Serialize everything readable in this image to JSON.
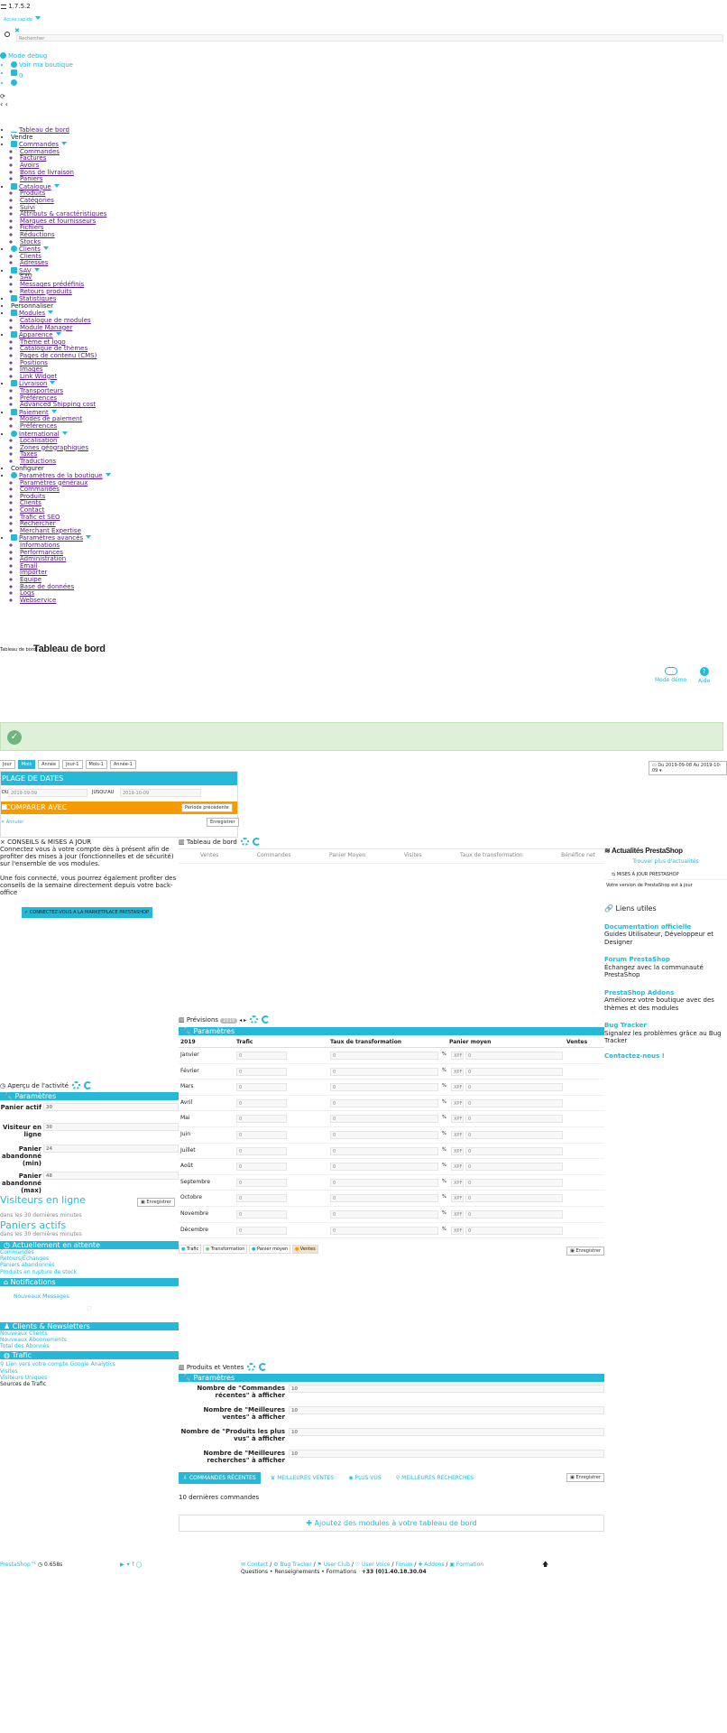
{
  "header": {
    "version": "1.7.5.2",
    "quick_access": "Accès rapide",
    "search_placeholder": "Rechercher",
    "debug_mode": "Mode debug",
    "view_shop": "Voir ma boutique",
    "notif_count": "0"
  },
  "nav": {
    "dashboard": "Tableau de bord",
    "section_sell": "Vendre",
    "orders": {
      "label": "Commandes",
      "items": [
        "Commandes",
        "Factures",
        "Avoirs",
        "Bons de livraison",
        "Paniers"
      ]
    },
    "catalog": {
      "label": "Catalogue",
      "items": [
        "Produits",
        "Catégories",
        "Suivi",
        "Attributs & caractéristiques",
        "Marques et fournisseurs",
        "Fichiers",
        "Réductions",
        "Stocks"
      ]
    },
    "customers": {
      "label": "Clients",
      "items": [
        "Clients",
        "Adresses"
      ]
    },
    "sav": {
      "label": "SAV",
      "items": [
        "SAV",
        "Messages prédéfinis",
        "Retours produits"
      ]
    },
    "stats": "Statistiques",
    "section_customize": "Personnaliser",
    "modules": {
      "label": "Modules",
      "items": [
        "Catalogue de modules",
        "Module Manager"
      ]
    },
    "appearance": {
      "label": "Apparence",
      "items": [
        "Thème et logo",
        "Catalogue de thèmes",
        "Pages de contenu (CMS)",
        "Positions",
        "Images",
        "Link Widget"
      ]
    },
    "shipping": {
      "label": "Livraison",
      "items": [
        "Transporteurs",
        "Préférences",
        "Advanced Shipping cost"
      ]
    },
    "payment": {
      "label": "Paiement",
      "items": [
        "Modes de paiement",
        "Préférences"
      ]
    },
    "international": {
      "label": "International",
      "items": [
        "Localisation",
        "Zones géographiques",
        "Taxes",
        "Traductions"
      ]
    },
    "section_configure": "Configurer",
    "shop_params": {
      "label": "Paramètres de la boutique",
      "items": [
        "Paramètres généraux",
        "Commandes",
        "Produits",
        "Clients",
        "Contact",
        "Trafic et SEO",
        "Rechercher",
        "Merchant Expertise"
      ]
    },
    "adv_params": {
      "label": "Paramètres avancés",
      "items": [
        "Informations",
        "Performances",
        "Administration",
        "Email",
        "Importer",
        "Equipe",
        "Base de données",
        "Logs",
        "Webservice"
      ]
    }
  },
  "page": {
    "breadcrumb": "Tableau de bord",
    "title": "Tableau de bord",
    "demo_mode": "Mode démo",
    "help": "Aide"
  },
  "date_bar": {
    "tabs": [
      "Jour",
      "Mois",
      "Année",
      "Jour-1",
      "Mois-1",
      "Année-1"
    ],
    "range": "Du 2019-09-08 Au 2019-10-09"
  },
  "date_panel": {
    "title": "PLAGE DE DATES",
    "from_label": "DU",
    "from_value": "2019-09-09",
    "to_label": "JUSQU'AU",
    "to_value": "2019-10-09",
    "compare_title": "COMPARER AVEC",
    "compare_select": "Période précédente",
    "cancel": "Annuler",
    "save": "Enregistrer"
  },
  "conseils": {
    "title": "CONSEILS & MISES A JOUR",
    "p1": "Connectez vous à votre compte dès à présent afin de profiter des mises à jour (fonctionnelles et de sécurité) sur l'ensemble de vos modules.",
    "p2": "Une fois connecté, vous pourrez également profiter des conseils de la semaine directement depuis votre back-office",
    "button": "CONNECTEZ-VOUS A LA MARKETPLACE PRESTASHOP"
  },
  "dashboard_kpis": {
    "title": "Tableau de bord",
    "cols": [
      "Ventes",
      "Commandes",
      "Panier Moyen",
      "Visites",
      "Taux de transformation",
      "Bénéfice net"
    ]
  },
  "news": {
    "title": "Actualités PrestaShop",
    "more": "Trouver plus d'actualités",
    "updates_title": "MISES À JOUR PRESTASHOP",
    "updates_text": "Votre version de PrestaShop est à jour"
  },
  "useful_links": {
    "title": "Liens utiles",
    "items": [
      {
        "title": "Documentation officielle",
        "desc": "Guides Utilisateur, Développeur et Designer"
      },
      {
        "title": "Forum PrestaShop",
        "desc": "Échangez avec la communauté PrestaShop"
      },
      {
        "title": "PrestaShop Addons",
        "desc": "Améliorez votre boutique avec des thèmes et des modules"
      },
      {
        "title": "Bug Tracker",
        "desc": "Signalez les problèmes grâce au Bug Tracker"
      }
    ],
    "contact": "Contactez-nous !"
  },
  "forecast": {
    "title": "Prévisions",
    "year_badge": "2019",
    "params": "Paramètres",
    "year": "2019",
    "cols": [
      "Trafic",
      "Taux de transformation",
      "Panier moyen",
      "Ventes"
    ],
    "months": [
      "Janvier",
      "Février",
      "Mars",
      "Avril",
      "Mai",
      "Juin",
      "Juillet",
      "Août",
      "Septembre",
      "Octobre",
      "Novembre",
      "Décembre"
    ],
    "default_value": "0",
    "percent": "%",
    "currency": "XPF",
    "legend": [
      "Trafic",
      "Transformation",
      "Panier moyen",
      "Ventes"
    ],
    "save": "Enregistrer"
  },
  "activity": {
    "title": "Aperçu de l'activité",
    "params": "Paramètres",
    "fields": [
      {
        "label": "Panier actif",
        "value": "30"
      },
      {
        "label": "Visiteur en ligne",
        "value": "30"
      },
      {
        "label": "Panier abandonné (min)",
        "value": "24"
      },
      {
        "label": "Panier abandonné (max)",
        "value": "48"
      }
    ],
    "save": "Enregistrer",
    "visitors_title": "Visiteurs en ligne",
    "visitors_sub": "dans les 30 dernières minutes",
    "carts_title": "Paniers actifs",
    "carts_sub": "dans les 30 dernières minutes",
    "pending_title": "Actuellement en attente",
    "pending_items": [
      "Commandes",
      "Retours/Échanges",
      "Paniers abandonnés",
      "Produits en rupture de stock"
    ],
    "notif_title": "Notifications",
    "notif_link": "Nouveaux Messages",
    "clients_title": "Clients & Newsletters",
    "clients_items": [
      "Nouveaux Clients",
      "Nouveaux Abonnements",
      "Total des Abonnés"
    ],
    "traffic_title": "Trafic",
    "traffic_items": [
      "Lien vers votre compte Google Analytics",
      "Visites",
      "Visiteurs Uniques",
      "Sources de Trafic"
    ]
  },
  "products_sales": {
    "title": "Produits et Ventes",
    "params": "Paramètres",
    "fields": [
      {
        "label": "Nombre de \"Commandes récentes\" à afficher",
        "value": "10"
      },
      {
        "label": "Nombre de \"Meilleures ventes\" à afficher",
        "value": "10"
      },
      {
        "label": "Nombre de \"Produits les plus vus\" à afficher",
        "value": "10"
      },
      {
        "label": "Nombre de \"Meilleures recherches\" à afficher",
        "value": "10"
      }
    ],
    "tabs": [
      "COMMANDES RÉCENTES",
      "MEILLEURES VENTES",
      "PLUS VUS",
      "MEILLEURES RECHERCHES"
    ],
    "save": "Enregistrer",
    "last_orders": "10 dernières commandes",
    "add_modules": "Ajoutez des modules à votre tableau de bord"
  },
  "footer": {
    "brand": "PrestaShop™",
    "time": "0.658s",
    "links": [
      "Contact",
      "Bug Tracker",
      "User Club",
      "User Voice",
      "Forum",
      "Addons",
      "Formation"
    ],
    "support": "Questions • Renseignements • Formations",
    "phone": "+33 (0)1.40.18.30.04"
  },
  "colors": {
    "accent": "#25b9d7",
    "orange": "#f59b00",
    "success_bg": "#dff0d8",
    "success_icon": "#70b580"
  }
}
